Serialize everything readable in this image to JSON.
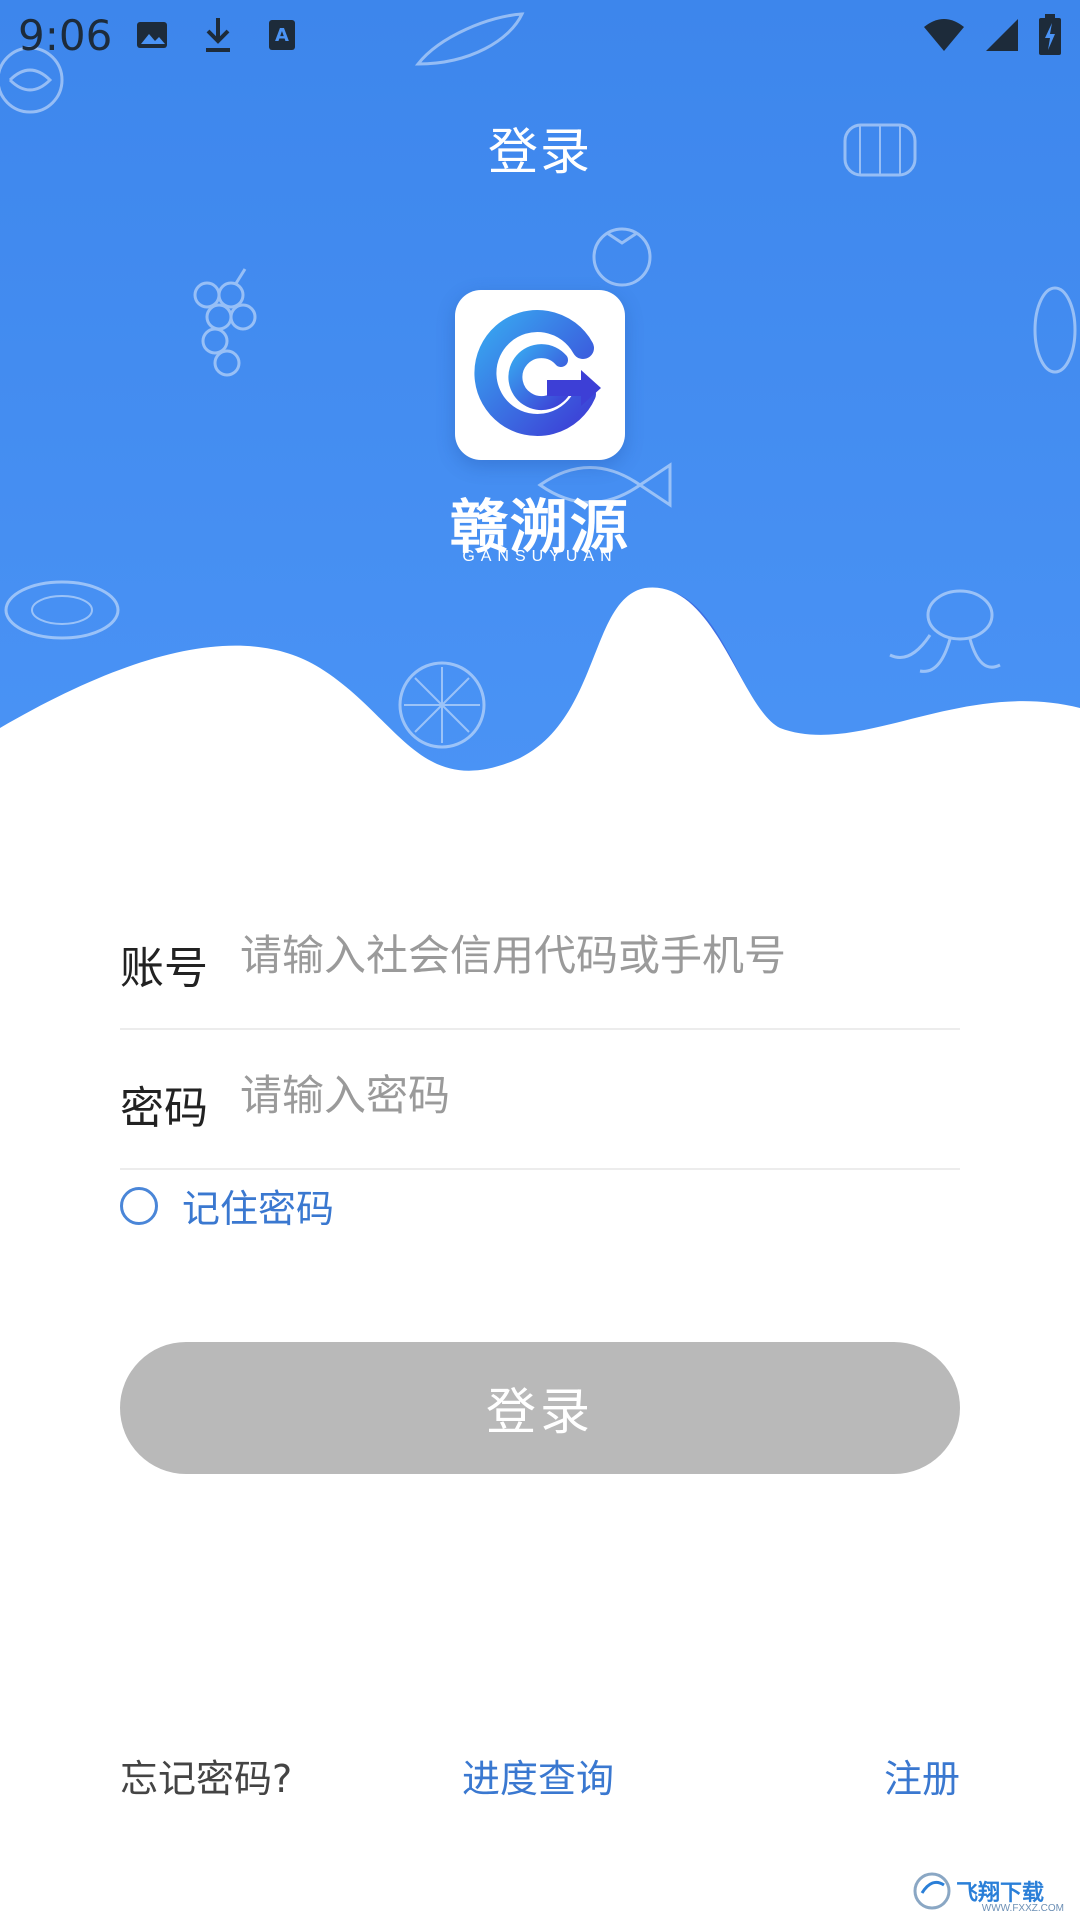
{
  "status_bar": {
    "time": "9:06",
    "left_icons": [
      "image-icon",
      "download-icon",
      "keyboard-a-icon"
    ],
    "right_icons": [
      "wifi-icon",
      "signal-icon",
      "battery-charging-icon"
    ]
  },
  "header": {
    "title": "登录"
  },
  "brand": {
    "name": "赣溯源",
    "subtitle": "GANSUYUAN",
    "icon": "brand-logo-icon"
  },
  "form": {
    "account": {
      "label": "账号",
      "placeholder": "请输入社会信用代码或手机号",
      "value": ""
    },
    "password": {
      "label": "密码",
      "placeholder": "请输入密码",
      "value": ""
    },
    "remember": {
      "label": "记住密码",
      "checked": false
    },
    "submit_label": "登录"
  },
  "footer": {
    "forgot": "忘记密码?",
    "progress": "进度查询",
    "register": "注册"
  },
  "colors": {
    "hero_blue": "#4a93f5",
    "link_blue": "#3a78d0",
    "button_disabled": "#b9b9b9"
  },
  "watermark": {
    "text": "飞翔下载",
    "url": "WWW.FXXZ.COM"
  }
}
